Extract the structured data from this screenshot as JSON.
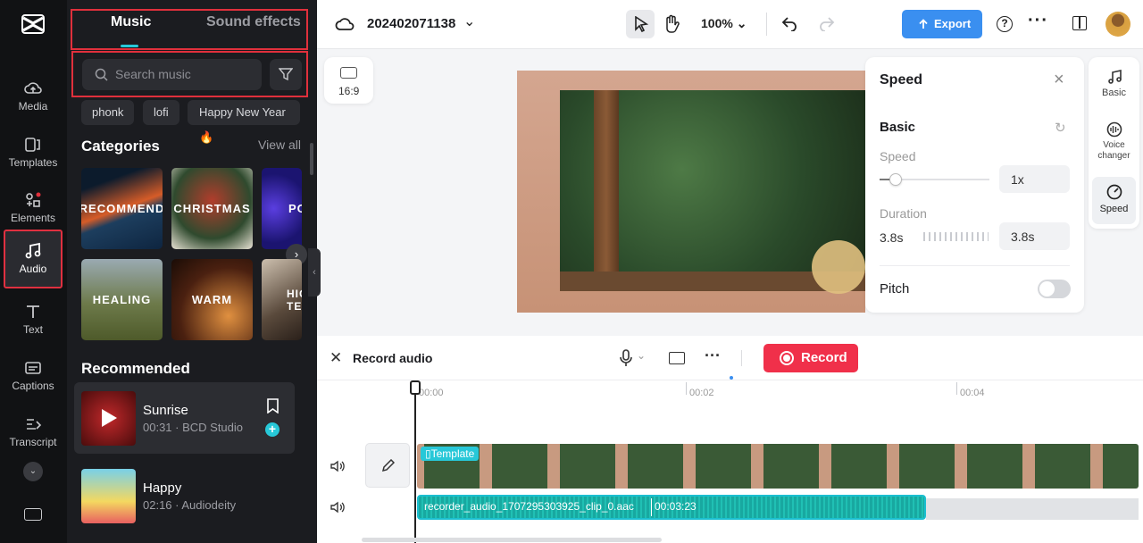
{
  "rail": {
    "items": [
      {
        "label": "Media",
        "icon": "cloud-upload-icon"
      },
      {
        "label": "Templates",
        "icon": "templates-icon"
      },
      {
        "label": "Elements",
        "icon": "elements-icon"
      },
      {
        "label": "Audio",
        "icon": "music-note-icon"
      },
      {
        "label": "Text",
        "icon": "text-icon"
      },
      {
        "label": "Captions",
        "icon": "captions-icon"
      },
      {
        "label": "Transcript",
        "icon": "transcript-icon"
      }
    ]
  },
  "panel": {
    "tabs": {
      "music": "Music",
      "sound_effects": "Sound effects"
    },
    "search_placeholder": "Search music",
    "chips": [
      "phonk",
      "lofi",
      "Happy New Year"
    ],
    "categories_title": "Categories",
    "view_all": "View all",
    "categories": [
      "RECOMMEND",
      "CHRISTMAS",
      "PO",
      "HEALING",
      "WARM",
      "HIG TEM"
    ],
    "recommended_title": "Recommended",
    "tracks": [
      {
        "title": "Sunrise",
        "meta": "00:31 · BCD Studio"
      },
      {
        "title": "Happy",
        "meta": "02:16 · Audiodeity"
      }
    ]
  },
  "topbar": {
    "project_name": "202402071138",
    "zoom": "100%",
    "export_label": "Export"
  },
  "canvas": {
    "ratio": "16:9"
  },
  "speed_panel": {
    "title": "Speed",
    "basic": "Basic",
    "speed_label": "Speed",
    "speed_value": "1x",
    "speed_level": 0.15,
    "duration_label": "Duration",
    "duration_from": "3.8s",
    "duration_to": "3.8s",
    "pitch_label": "Pitch"
  },
  "right_tabs": [
    "Basic",
    "Voice changer",
    "Speed"
  ],
  "timeline": {
    "record_audio": "Record audio",
    "record_label": "Record",
    "ticks": [
      "00:00",
      "00:02",
      "00:04"
    ],
    "template_label": "Template",
    "audio_clip": "recorder_audio_1707295303925_clip_0.aac",
    "audio_duration": "00:03:23"
  }
}
